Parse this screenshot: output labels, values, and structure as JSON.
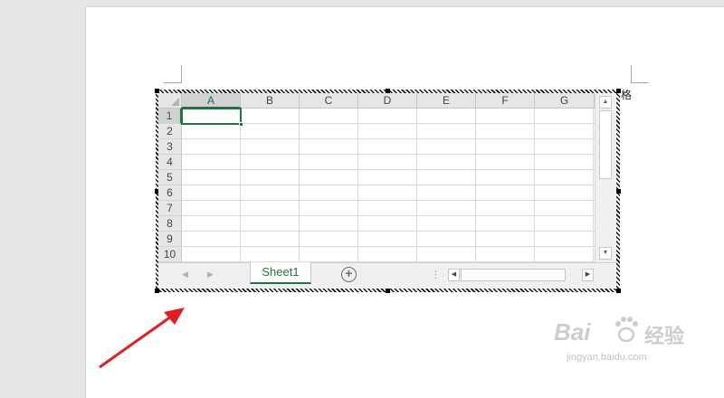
{
  "side_text": "格",
  "spreadsheet": {
    "columns": [
      "A",
      "B",
      "C",
      "D",
      "E",
      "F",
      "G"
    ],
    "rows": [
      "1",
      "2",
      "3",
      "4",
      "5",
      "6",
      "7",
      "8",
      "9",
      "10"
    ],
    "active_cell": "A1",
    "sheet_tab": "Sheet1",
    "add_sheet_symbol": "+",
    "nav_prev": "◀",
    "nav_next": "▶",
    "scroll_up": "▲",
    "scroll_down": "▼",
    "scroll_left": "◀",
    "scroll_right": "▶",
    "splitter": "⋮"
  },
  "watermark": {
    "logo": "Bai",
    "logo_suffix": "经验",
    "url": "jingyan.baidu.com"
  },
  "colors": {
    "accent": "#217346",
    "arrow": "#e02020"
  }
}
